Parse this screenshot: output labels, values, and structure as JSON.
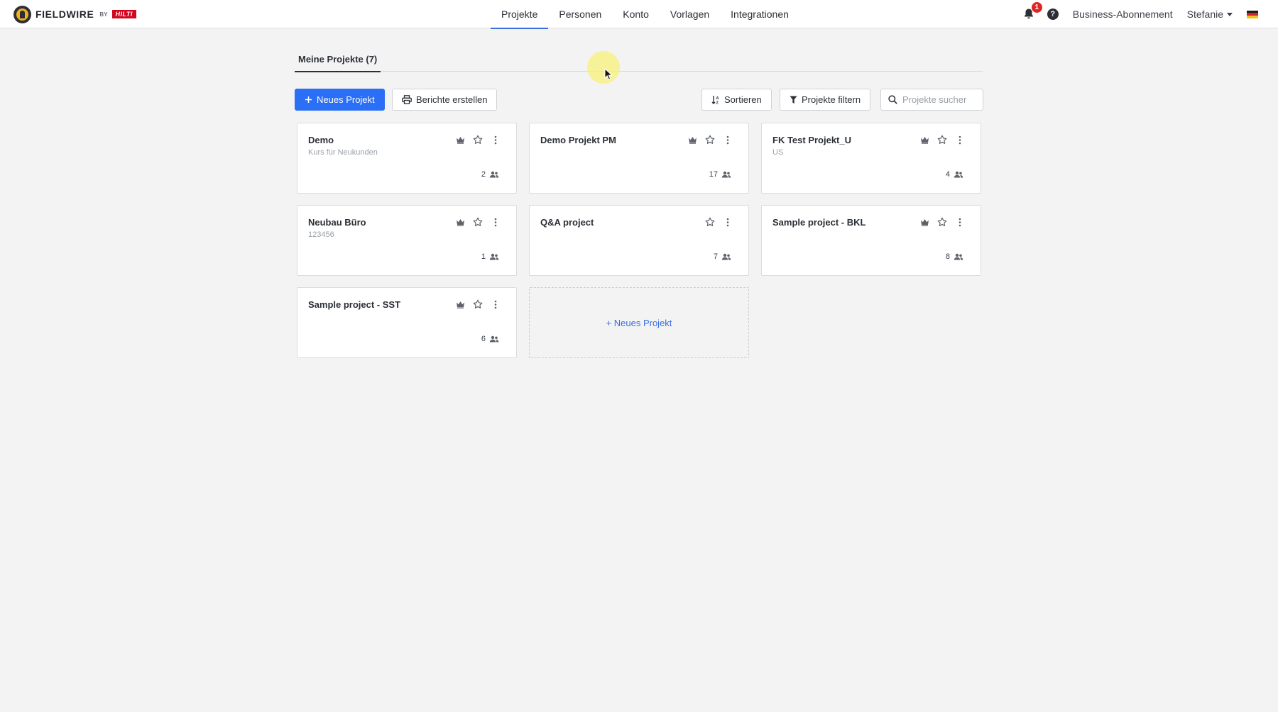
{
  "brand": {
    "name": "FIELDWIRE",
    "by": "BY",
    "partner": "HILTI"
  },
  "nav": {
    "items": [
      {
        "label": "Projekte",
        "active": true
      },
      {
        "label": "Personen",
        "active": false
      },
      {
        "label": "Konto",
        "active": false
      },
      {
        "label": "Vorlagen",
        "active": false
      },
      {
        "label": "Integrationen",
        "active": false
      }
    ]
  },
  "header_right": {
    "notifications_count": "1",
    "help_icon": "?",
    "plan_label": "Business-Abonnement",
    "user_name": "Stefanie",
    "language_flag": "german-flag-icon"
  },
  "tabs": [
    {
      "label": "Meine Projekte (7)",
      "active": true
    }
  ],
  "toolbar": {
    "new_project_label": "Neues Projekt",
    "reports_label": "Berichte erstellen",
    "sort_label": "Sortieren",
    "filter_label": "Projekte filtern",
    "search_placeholder": "Projekte sucher"
  },
  "projects": [
    {
      "title": "Demo",
      "subtitle": "Kurs für Neukunden",
      "members": "2",
      "crown": true
    },
    {
      "title": "Demo Projekt PM",
      "subtitle": "",
      "members": "17",
      "crown": true
    },
    {
      "title": "FK Test Projekt_U",
      "subtitle": "US",
      "members": "4",
      "crown": true
    },
    {
      "title": "Neubau Büro",
      "subtitle": "123456",
      "members": "1",
      "crown": true
    },
    {
      "title": "Q&A project",
      "subtitle": "",
      "members": "7",
      "crown": false
    },
    {
      "title": "Sample project - BKL",
      "subtitle": "",
      "members": "8",
      "crown": true
    },
    {
      "title": "Sample project - SST",
      "subtitle": "",
      "members": "6",
      "crown": true
    }
  ],
  "new_project_card_label": "+ Neues Projekt",
  "colors": {
    "accent": "#2a6ff5",
    "link": "#3a6de0",
    "badge": "#e02424",
    "brand_yellow": "#f2b01e",
    "hilti_red": "#d2051e"
  }
}
